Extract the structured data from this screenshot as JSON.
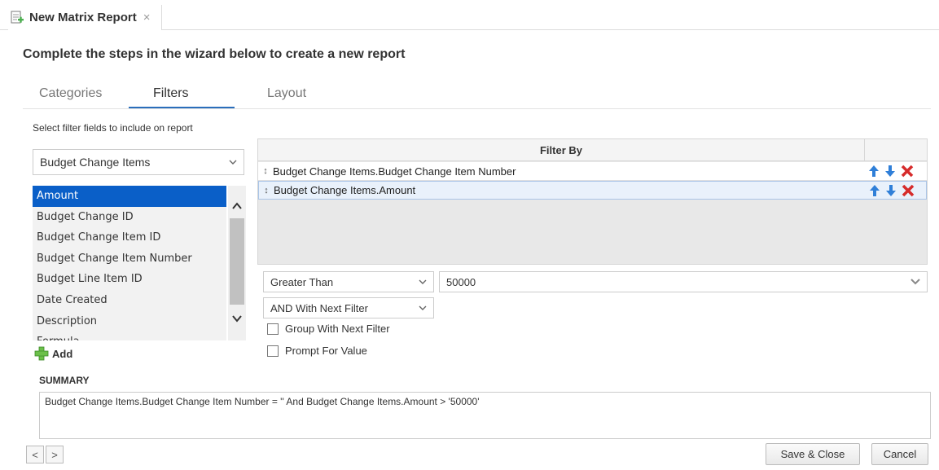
{
  "tab": {
    "title": "New Matrix Report",
    "close": "×"
  },
  "heading": "Complete the steps in the wizard below to create a new report",
  "steps": [
    {
      "label": "Categories",
      "active": false
    },
    {
      "label": "Filters",
      "active": true
    },
    {
      "label": "Layout",
      "active": false
    }
  ],
  "hint": "Select filter fields to include on report",
  "category_select": {
    "value": "Budget Change Items"
  },
  "fields": [
    "Amount",
    "Budget Change ID",
    "Budget Change Item ID",
    "Budget Change Item Number",
    "Budget Line Item ID",
    "Date Created",
    "Description",
    "Formula"
  ],
  "selected_field": "Amount",
  "add_label": "Add",
  "filter_grid": {
    "header": "Filter By",
    "rows": [
      {
        "handle": "↕",
        "label": "Budget Change Items.Budget Change Item Number"
      },
      {
        "handle": "↕",
        "label": "Budget Change Items.Amount"
      }
    ]
  },
  "operator_select": {
    "value": "Greater Than"
  },
  "value_input": {
    "value": "50000"
  },
  "logic_select": {
    "value": "AND With Next Filter"
  },
  "checkboxes": {
    "group": "Group With Next Filter",
    "prompt": "Prompt For Value"
  },
  "summary": {
    "label": "SUMMARY",
    "text": "Budget Change Items.Budget Change Item Number = '' And Budget Change Items.Amount > '50000'"
  },
  "nav": {
    "prev": "<",
    "next": ">"
  },
  "buttons": {
    "save": "Save & Close",
    "cancel": "Cancel"
  },
  "colors": {
    "accent": "#2a6ebb",
    "selection": "#0a5fc8",
    "delete": "#d62b2b",
    "arrow": "#2f7fd8",
    "add": "#5cb85c"
  }
}
